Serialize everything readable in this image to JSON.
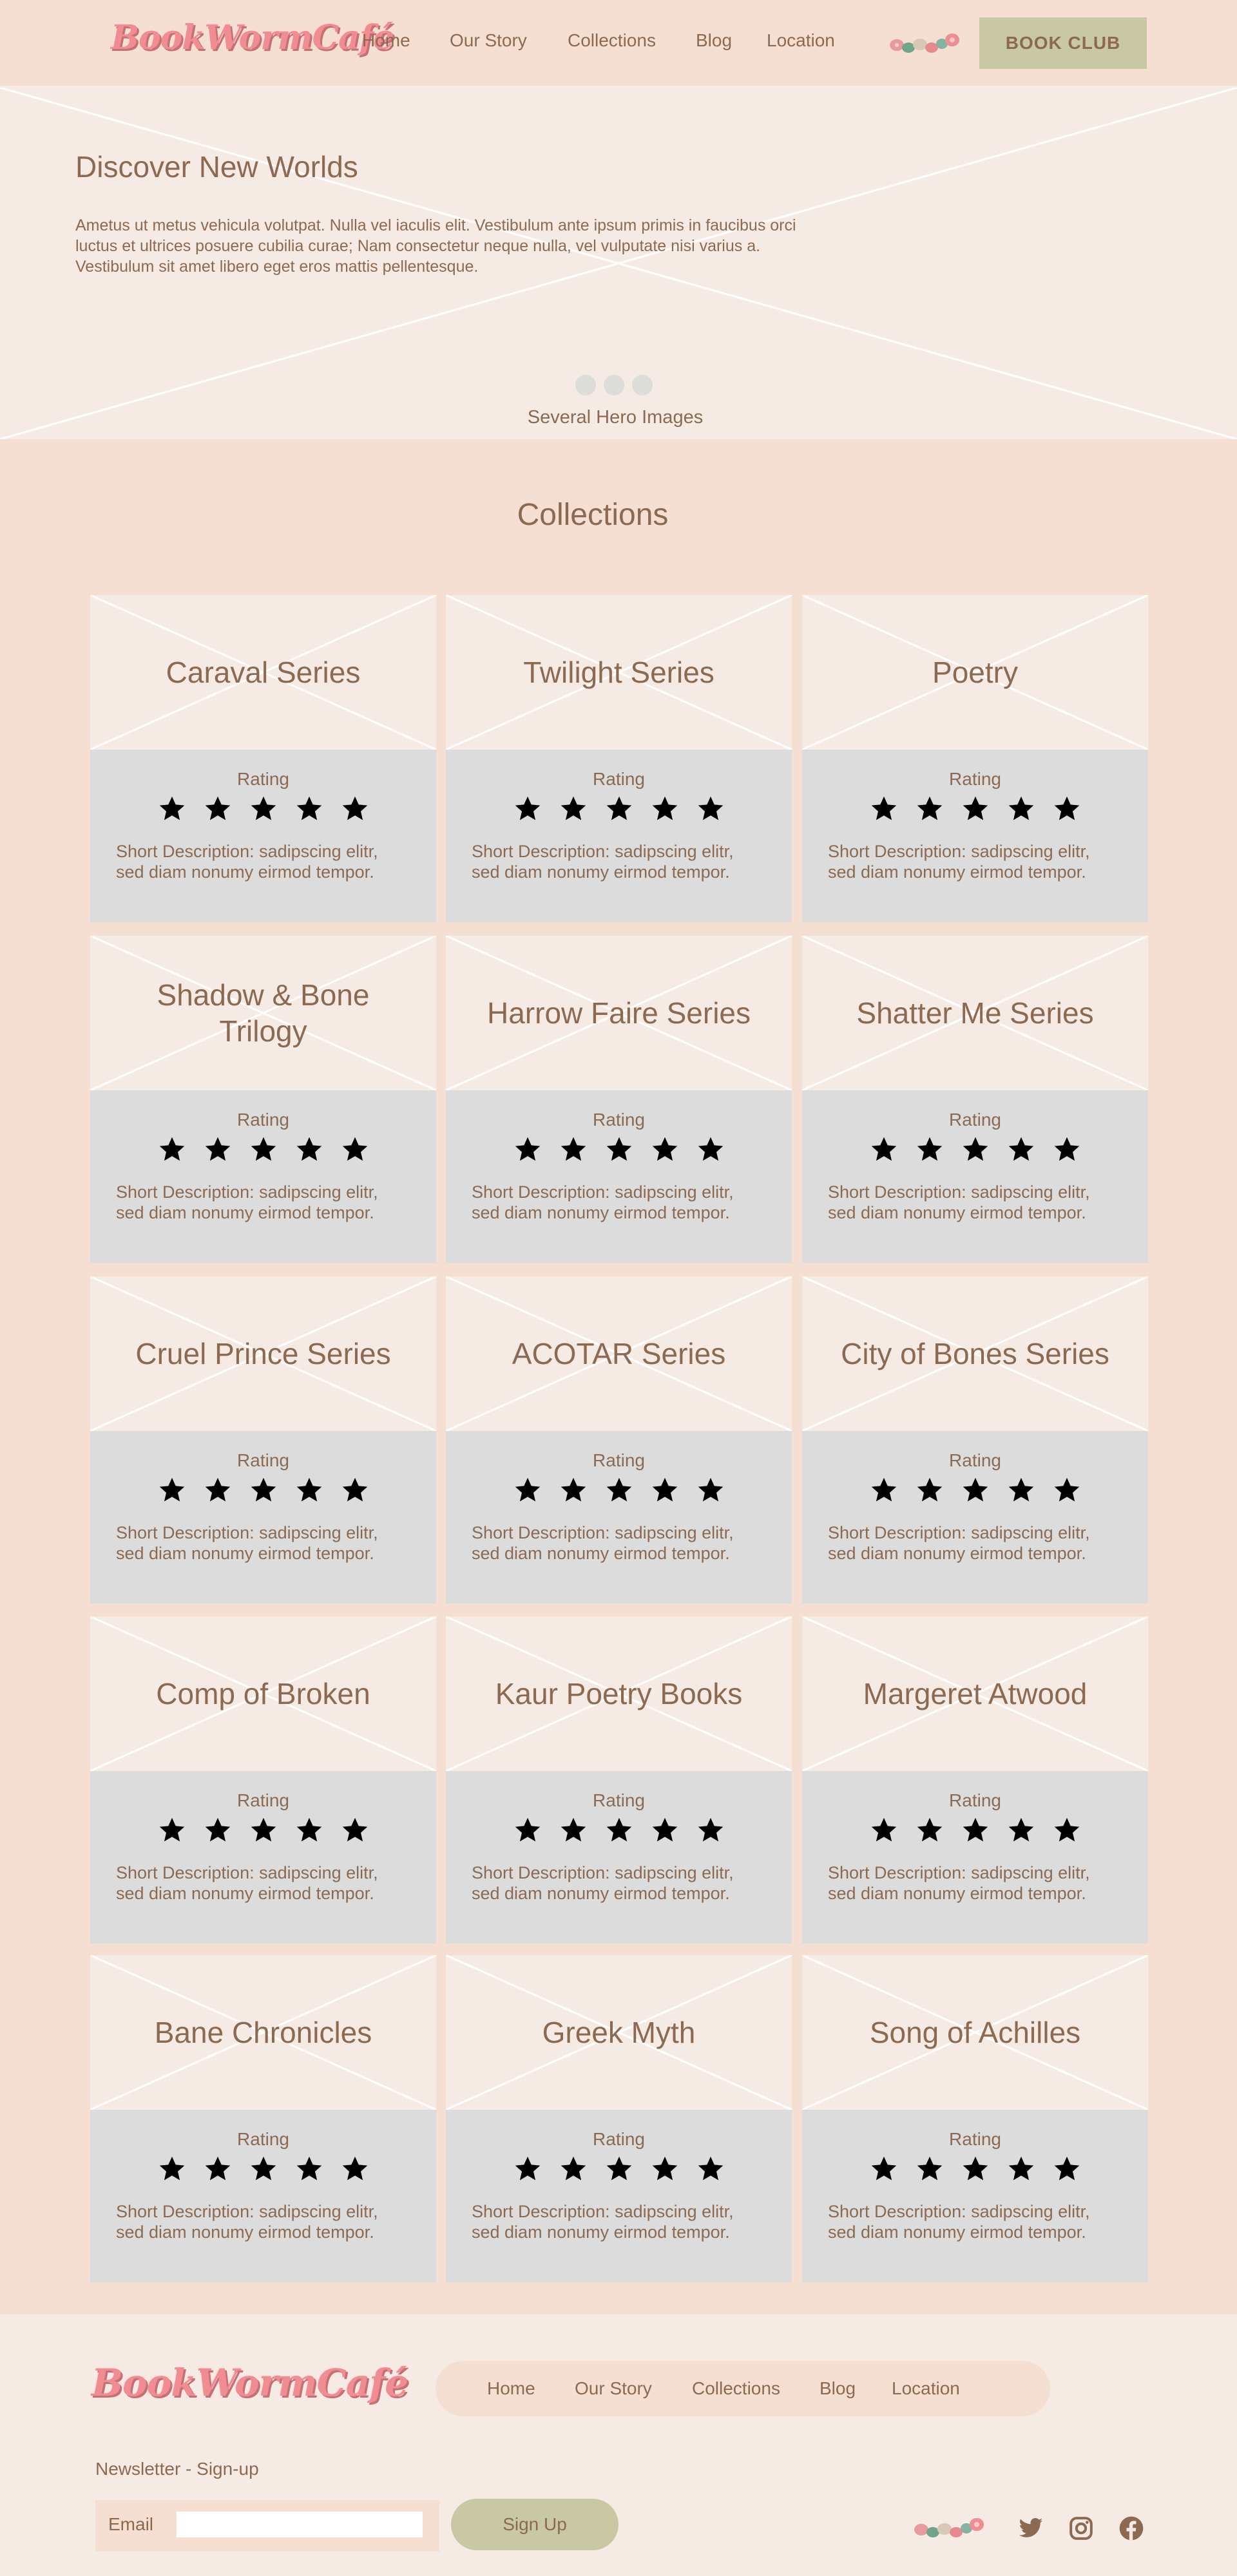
{
  "brand": {
    "logo_text": "BookWormCafé"
  },
  "nav": {
    "links": [
      "Home",
      "Our Story",
      "Collections",
      "Blog",
      "Location"
    ],
    "book_club_label": "BOOK CLUB"
  },
  "hero": {
    "title": "Discover New Worlds",
    "text": "Ametus ut metus vehicula volutpat. Nulla vel iaculis elit. Vestibulum ante ipsum primis in faucibus orci luctus et ultrices posuere cubilia curae; Nam consectetur neque nulla, vel vulputate nisi varius a. Vestibulum sit amet libero eget eros mattis pellentesque.",
    "caption": "Several Hero Images",
    "slide_count": 3
  },
  "collections": {
    "title": "Collections",
    "rating_label": "Rating",
    "items": [
      {
        "title": "Caraval Series",
        "stars": 5,
        "description": "Short Description: sadipscing elitr, sed diam nonumy eirmod tempor."
      },
      {
        "title": "Twilight Series",
        "stars": 5,
        "description": "Short Description: sadipscing elitr, sed diam nonumy eirmod tempor."
      },
      {
        "title": "Poetry",
        "stars": 5,
        "description": "Short Description: sadipscing elitr, sed diam nonumy eirmod tempor."
      },
      {
        "title": "Shadow & Bone Trilogy",
        "stars": 5,
        "description": "Short Description: sadipscing elitr, sed diam nonumy eirmod tempor."
      },
      {
        "title": "Harrow Faire Series",
        "stars": 5,
        "description": "Short Description: sadipscing elitr, sed diam nonumy eirmod tempor."
      },
      {
        "title": "Shatter Me Series",
        "stars": 5,
        "description": "Short Description: sadipscing elitr, sed diam nonumy eirmod tempor."
      },
      {
        "title": "Cruel Prince Series",
        "stars": 5,
        "description": "Short Description: sadipscing elitr, sed diam nonumy eirmod tempor."
      },
      {
        "title": "ACOTAR Series",
        "stars": 5,
        "description": "Short Description: sadipscing elitr, sed diam nonumy eirmod tempor."
      },
      {
        "title": "City of Bones Series",
        "stars": 5,
        "description": "Short Description: sadipscing elitr, sed diam nonumy eirmod tempor."
      },
      {
        "title": "Comp of Broken",
        "stars": 5,
        "description": "Short Description: sadipscing elitr, sed diam nonumy eirmod tempor."
      },
      {
        "title": "Kaur Poetry Books",
        "stars": 5,
        "description": "Short Description: sadipscing elitr, sed diam nonumy eirmod tempor."
      },
      {
        "title": "Margeret Atwood",
        "stars": 5,
        "description": "Short Description: sadipscing elitr, sed diam nonumy eirmod tempor."
      },
      {
        "title": "Bane Chronicles",
        "stars": 5,
        "description": "Short Description: sadipscing elitr, sed diam nonumy eirmod tempor."
      },
      {
        "title": "Greek Myth",
        "stars": 5,
        "description": "Short Description: sadipscing elitr, sed diam nonumy eirmod tempor."
      },
      {
        "title": "Song of Achilles",
        "stars": 5,
        "description": "Short Description: sadipscing elitr, sed diam nonumy eirmod tempor."
      }
    ]
  },
  "footer": {
    "links": [
      "Home",
      "Our Story",
      "Collections",
      "Blog",
      "Location"
    ],
    "newsletter_label": "Newsletter - Sign-up",
    "email_label": "Email",
    "email_value": "",
    "signup_label": "Sign Up",
    "social_icons": [
      "twitter-icon",
      "instagram-icon",
      "facebook-icon"
    ]
  },
  "colors": {
    "page_bg": "#f4dfd2",
    "light_bg": "#f6ebe4",
    "card_body_bg": "#dcdcdc",
    "text": "#8c6a52",
    "button_bg": "#c9c8a5",
    "logo_pink": "#f08d92",
    "star": "#000000"
  }
}
